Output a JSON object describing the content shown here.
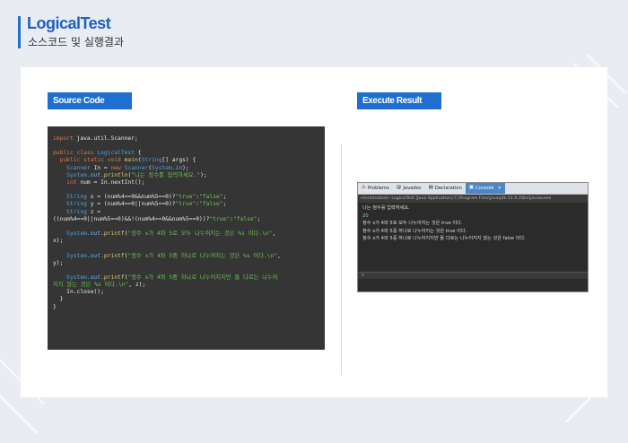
{
  "header": {
    "title": "LogicalTest",
    "subtitle": "소스코드 및 실행결과"
  },
  "labels": {
    "source_code": "Source Code",
    "execute_result": "Execute Result"
  },
  "code": {
    "l1_kw": "import",
    "l1_rest": " java.util.Scanner;",
    "l2_kw": "public class",
    "l2_cls": " LogicalTest",
    "l2_rest": " {",
    "l3_kw": "public static void",
    "l3_fn": " main",
    "l3_p1": "(",
    "l3_ty": "String",
    "l3_p2": "[] args) {",
    "l4_ty": "Scanner",
    "l4_mid": " In = ",
    "l4_kw": "new",
    "l4_ty2": " Scanner",
    "l4_p1": "(",
    "l4_sys": "System",
    "l4_fld": ".in",
    "l4_p2": ");",
    "l5_sys": "System",
    "l5_fld": ".out",
    "l5_fn": ".println",
    "l5_p1": "(",
    "l5_str": "\"나는 정수를 입력하세요.\"",
    "l5_p2": ");",
    "l6_kw": "int",
    "l6_rest": " num = In.nextInt();",
    "l7_ty": "String",
    "l7_rest": " x = (num%4==0&&num%5==0)?",
    "l7_s1": "\"true\"",
    "l7_c": ":",
    "l7_s2": "\"false\"",
    "l7_end": ";",
    "l8_ty": "String",
    "l8_rest": " y = (num%4==0||num%5==0)?",
    "l8_s1": "\"true\"",
    "l8_c": ":",
    "l8_s2": "\"false\"",
    "l8_end": ";",
    "l9_ty": "String",
    "l9_rest": " z =",
    "l10_rest": "((num%4==0||num%5==0)&&!(num%4==0&&num%5==0))?",
    "l10_s1": "\"true\"",
    "l10_c": ":",
    "l10_s2": "\"false\"",
    "l10_end": ";",
    "l11_sys": "System",
    "l11_fld": ".out",
    "l11_fn": ".printf",
    "l11_p1": "(",
    "l11_str": "\"정수 x가 4와 5로 모두 나누어지는 것은 %s 이다.\\n\"",
    "l11_end": ",",
    "l12": "x);",
    "l13_sys": "System",
    "l13_fld": ".out",
    "l13_fn": ".printf",
    "l13_p1": "(",
    "l13_str": "\"정수 x가 4와 5중 하나로 나누어지는 것은 %s 이다.\\n\"",
    "l13_end": ",",
    "l14": "y);",
    "l15_sys": "System",
    "l15_fld": ".out",
    "l15_fn": ".printf",
    "l15_p1": "(",
    "l15_str": "\"정수 x가 4와 5중 하나로 나누어지지만 둘 다로는 나누어",
    "l16_str": "지지 않는 것은 %s 이다.\\n\"",
    "l16_end": ", z);",
    "l17": "In.close();",
    "l18": "}",
    "l19": "}"
  },
  "console": {
    "tabs": [
      {
        "icon": "⚠",
        "label": "Problems"
      },
      {
        "icon": "@",
        "label": "Javadoc"
      },
      {
        "icon": "▤",
        "label": "Declaration"
      },
      {
        "icon": "▣",
        "label": "Console",
        "close": "✕"
      }
    ],
    "terminated": "<terminated> LogicalTest [Java Application] C:\\Program Files\\Java\\jdk-11.0.2\\bin\\javaw.exe",
    "lines": [
      "나는 정수를 입력하세요.",
      "20",
      "정수 x가 4와 5로 모두 나누어지는 것은 true 이다.",
      "정수 x가 4와 5중 하나로 나누어지는 것은 true 이다.",
      "정수 x가 4와 5중 하나로 나누어지지만 둘 다로는 나누어지지 않는 것은 false 이다."
    ],
    "footer": "<"
  },
  "colors": {
    "accent": "#1f6fd1",
    "code_bg": "#353535",
    "console_bg": "#2b2b2b"
  }
}
